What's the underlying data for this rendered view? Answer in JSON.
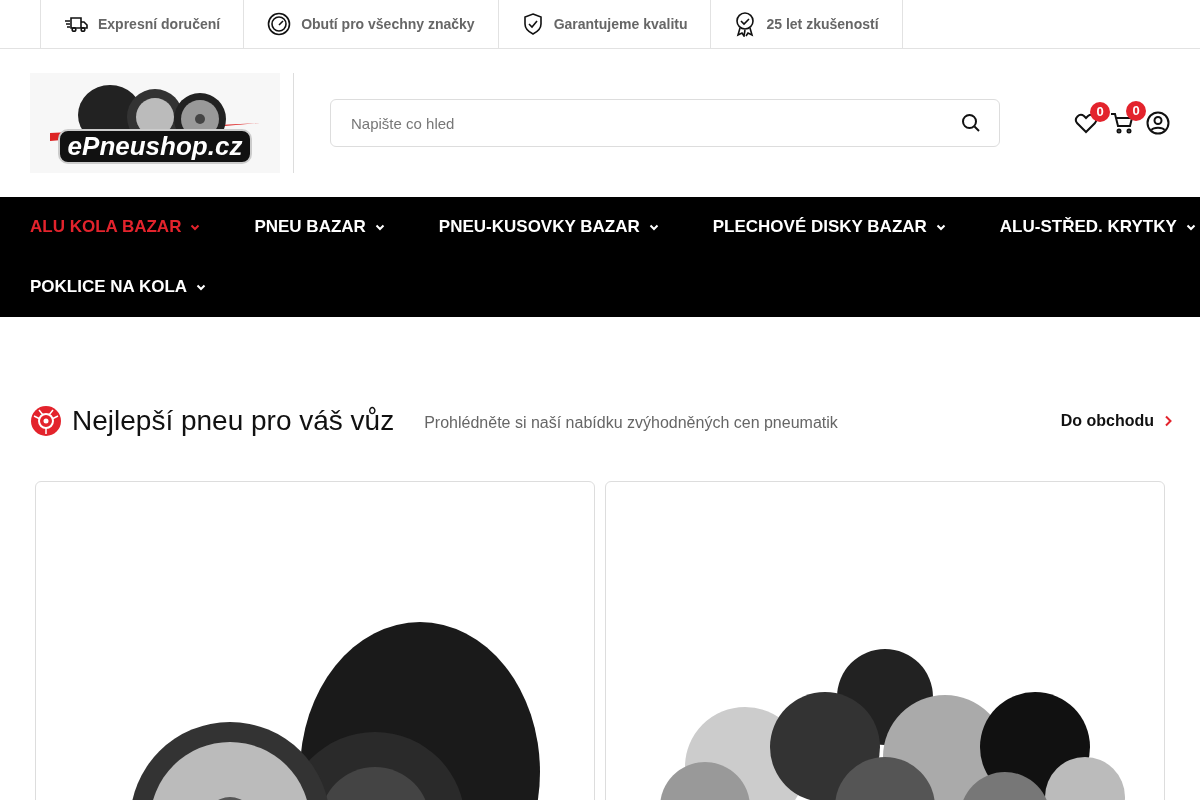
{
  "top_bar": [
    {
      "kind": "truck",
      "label": "Expresní doručení"
    },
    {
      "kind": "gauge",
      "label": "Obutí pro všechny značky"
    },
    {
      "kind": "shield",
      "label": "Garantujeme kvalitu"
    },
    {
      "kind": "award",
      "label": "25 let zkušeností"
    }
  ],
  "header": {
    "logo_text": "ePneushop.cz",
    "search": {
      "placeholder": "Napište co hled"
    },
    "wishlist_count": "0",
    "cart_count": "0"
  },
  "nav": [
    {
      "label": "ALU KOLA BAZAR",
      "selected": true
    },
    {
      "label": "PNEU BAZAR",
      "selected": false
    },
    {
      "label": "PNEU-KUSOVKY BAZAR",
      "selected": false
    },
    {
      "label": "PLECHOVÉ DISKY BAZAR",
      "selected": false
    },
    {
      "label": "ALU-STŘED. KRYTKY",
      "selected": false
    },
    {
      "label": "POKLICE NA KOLA",
      "selected": false
    }
  ],
  "section": {
    "title": "Nejlepší pneu pro váš vůz",
    "subtitle": "Prohlédněte si naší nabídku zvýhodněných cen pneumatik",
    "link": "Do obchodu"
  },
  "cards": [
    {
      "kind": "wheel-tyre"
    },
    {
      "kind": "wheels"
    }
  ]
}
